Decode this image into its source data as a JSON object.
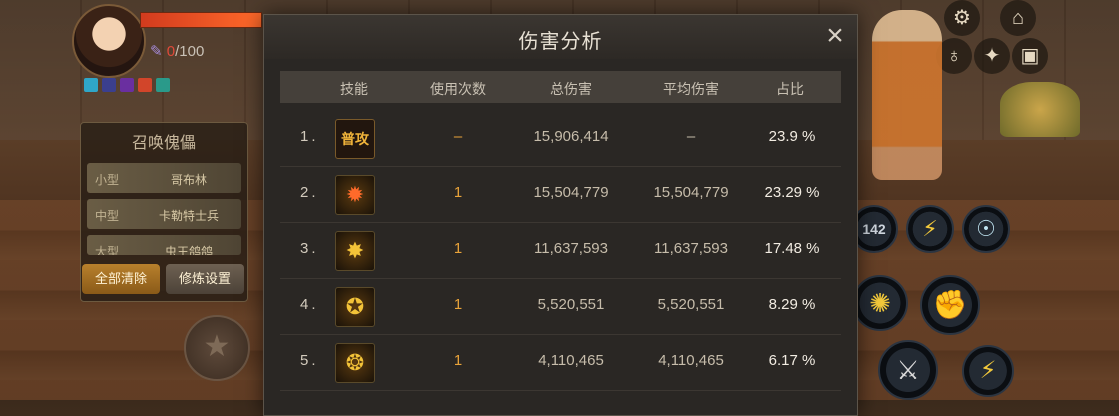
{
  "hud": {
    "mp_current": "0",
    "mp_total": "/100",
    "summon": {
      "title": "召唤傀儡",
      "rows": [
        {
          "size": "小型",
          "name": "哥布林"
        },
        {
          "size": "中型",
          "name": "卡勒特士兵"
        },
        {
          "size": "大型",
          "name": "虫王鸽鸽"
        }
      ],
      "clear_label": "全部清除",
      "settings_label": "修炼设置"
    },
    "skill_counter": "142"
  },
  "dialog": {
    "title": "伤害分析",
    "close_icon": "×",
    "columns": [
      "技能",
      "使用次数",
      "总伤害",
      "平均伤害",
      "占比"
    ],
    "rows": [
      {
        "index": "1.",
        "icon": "普攻",
        "count": "–",
        "total": "15,906,414",
        "avg": "–",
        "pct": "23.9 %"
      },
      {
        "index": "2.",
        "icon": "flower-burst-icon",
        "count": "1",
        "total": "15,504,779",
        "avg": "15,504,779",
        "pct": "23.29 %"
      },
      {
        "index": "3.",
        "icon": "dragon-roar-icon",
        "count": "1",
        "total": "11,637,593",
        "avg": "11,637,593",
        "pct": "17.48 %"
      },
      {
        "index": "4.",
        "icon": "golden-fist-icon",
        "count": "1",
        "total": "5,520,551",
        "avg": "5,520,551",
        "pct": "8.29 %"
      },
      {
        "index": "5.",
        "icon": "tiger-head-icon",
        "count": "1",
        "total": "4,110,465",
        "avg": "4,110,465",
        "pct": "6.17 %"
      }
    ]
  },
  "colors": {
    "accent": "#e8a33a",
    "hp": "#e04a3a"
  }
}
